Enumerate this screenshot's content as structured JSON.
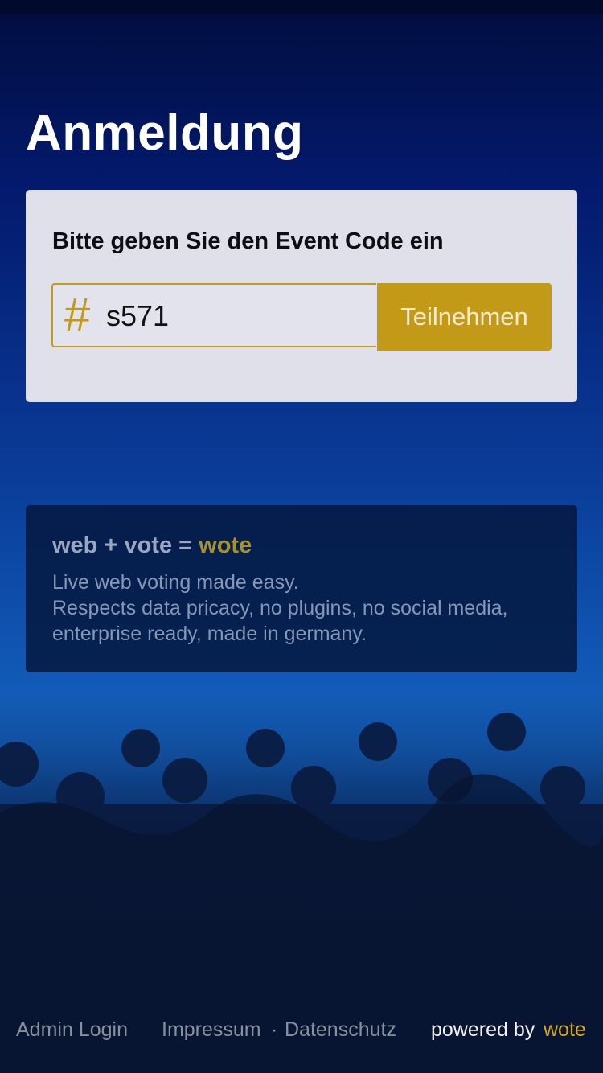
{
  "page": {
    "title": "Anmeldung"
  },
  "login": {
    "prompt": "Bitte geben Sie den Event Code ein",
    "hash_symbol": "#",
    "code_value": "s571",
    "join_label": "Teilnehmen"
  },
  "info": {
    "heading_prefix": "web + vote = ",
    "heading_brand": "wote",
    "line1": "Live web voting made easy.",
    "line2": "Respects data pricacy, no plugins, no social media, enterprise ready, made in germany."
  },
  "footer": {
    "admin_login": "Admin Login",
    "impressum": "Impressum",
    "separator": "·",
    "datenschutz": "Datenschutz",
    "powered_by": "powered by",
    "powered_brand": "wote"
  },
  "colors": {
    "accent": "#c39a18",
    "brand": "#d6a824",
    "background_top": "#020d3e",
    "background_mid": "#0a3d9a",
    "card_background": "#dfe0ea"
  }
}
